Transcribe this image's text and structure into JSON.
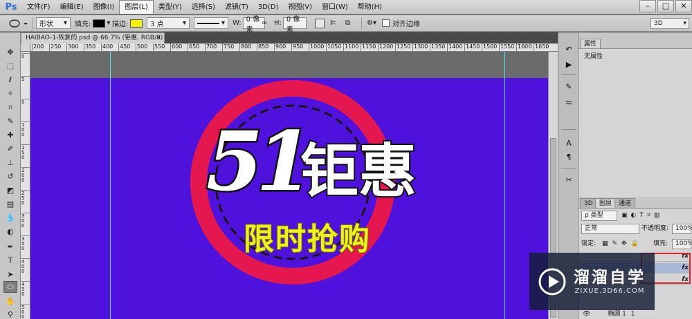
{
  "app": {
    "logo": "Ps"
  },
  "menu": [
    "文件(F)",
    "编辑(E)",
    "图像(I)",
    "图层(L)",
    "类型(Y)",
    "选择(S)",
    "滤镜(T)",
    "3D(D)",
    "视图(V)",
    "窗口(W)",
    "帮助(H)"
  ],
  "menu_active_index": 3,
  "window_controls": {
    "minimize": "–",
    "maximize": "□",
    "close": "✕"
  },
  "options": {
    "mode": "形状",
    "fill_label": "填充:",
    "stroke_label": "描边:",
    "stroke_size": "3 点",
    "w_label": "W:",
    "w_value": "0 像素",
    "h_label": "H:",
    "h_value": "0 像素",
    "align_edges": "对齐边缘",
    "fill_color": "#000000",
    "stroke_color": "#f6f300"
  },
  "document": {
    "tab_title": "HAIBAO-1-恢复的.psd @ 66.7% (钜惠, RGB/8) *",
    "tab_close": "×"
  },
  "ruler_top": [
    "200",
    "250",
    "300",
    "350",
    "400",
    "450",
    "500",
    "550",
    "600",
    "650",
    "700",
    "750",
    "800",
    "850",
    "900",
    "950",
    "1000",
    "1050",
    "1100",
    "1150",
    "1200",
    "1250",
    "1300",
    "1350",
    "1400",
    "1450",
    "1500",
    "1550",
    "1600",
    "1650"
  ],
  "ruler_left": [
    "0",
    "5",
    "0",
    "1 0 0",
    "1 5 0",
    "2 0 0",
    "2 5 0",
    "3 0 0",
    "3 5 0",
    "4 0 0",
    "4 5 0",
    "5 0 0"
  ],
  "artwork": {
    "headline_number": "51",
    "headline_text": "钜惠",
    "sub_text": "限时抢购",
    "ring_color": "#e5174f",
    "background_color": "#4f12dc",
    "sub_text_color": "#ecf21a"
  },
  "workspace": {
    "label": "3D",
    "caret": "▾"
  },
  "properties_panel": {
    "tab": "属性",
    "empty_text": "无属性"
  },
  "layers_panel": {
    "tabs": [
      "3D",
      "图层",
      "通道"
    ],
    "filter_label": "ρ 类型",
    "blend_mode": "正常",
    "opacity_label": "不透明度:",
    "opacity_value": "100%",
    "lock_label": "锁定:",
    "fill_label": "填充:",
    "fill_value": "100%",
    "fx_label": "fx",
    "bottom_layer": "椭圆 1",
    "bottom_layer_number": "1"
  },
  "watermark": {
    "title": "溜溜自学",
    "url": "ZIXUE.3D66.COM"
  },
  "icons": {
    "toolbar": [
      "move-icon",
      "marquee-icon",
      "lasso-icon",
      "quick-select-icon",
      "crop-icon",
      "eyedropper-icon",
      "healing-brush-icon",
      "brush-icon",
      "clone-stamp-icon",
      "history-brush-icon",
      "eraser-icon",
      "gradient-icon",
      "blur-icon",
      "dodge-icon",
      "pen-icon",
      "type-icon",
      "path-select-icon",
      "ellipse-icon",
      "hand-icon",
      "zoom-icon"
    ],
    "dock": [
      "history-icon",
      "actions-icon",
      "brush-preset-icon",
      "adjustments-icon",
      "character-icon",
      "paragraph-icon",
      "tool-presets-icon"
    ]
  }
}
